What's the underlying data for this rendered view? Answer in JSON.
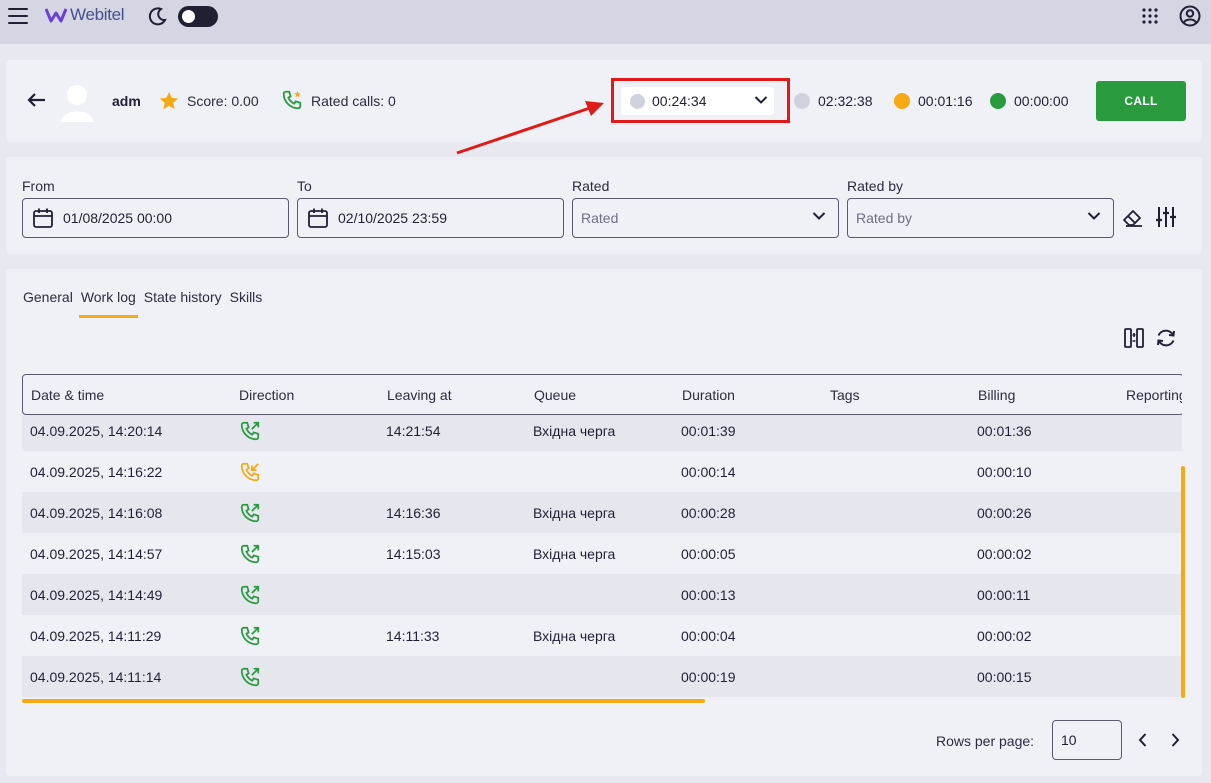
{
  "header": {
    "brand": "Webitel",
    "icons": [
      "menu-icon",
      "moon-icon",
      "theme-toggle",
      "apps-grid-icon",
      "profile-icon"
    ]
  },
  "agent": {
    "name": "adm",
    "score": "Score: 0.00",
    "rated_calls": "Rated calls: 0",
    "status_value": "00:24:34",
    "stats": [
      {
        "value": "02:32:38",
        "color": "#cfd1dc"
      },
      {
        "value": "00:01:16",
        "color": "#f7a913"
      },
      {
        "value": "00:00:00",
        "color": "#2a9a3f"
      }
    ],
    "call_label": "CALL"
  },
  "filters": {
    "from_label": "From",
    "from_value": "01/08/2025 00:00",
    "to_label": "To",
    "to_value": "02/10/2025 23:59",
    "rated_label": "Rated",
    "rated_placeholder": "Rated",
    "rated_by_label": "Rated by",
    "rated_by_placeholder": "Rated by"
  },
  "tabs": [
    "General",
    "Work log",
    "State history",
    "Skills"
  ],
  "active_tab": "Work log",
  "table": {
    "columns": [
      "Date & time",
      "Direction",
      "Leaving at",
      "Queue",
      "Duration",
      "Tags",
      "Billing",
      "Reporting"
    ],
    "rows": [
      {
        "datetime": "04.09.2025, 14:20:14",
        "direction": "outbound",
        "leaving_at": "14:21:54",
        "queue": "Вхідна черга",
        "duration": "00:01:39",
        "tags": "",
        "billing": "00:01:36"
      },
      {
        "datetime": "04.09.2025, 14:16:22",
        "direction": "missed",
        "leaving_at": "",
        "queue": "",
        "duration": "00:00:14",
        "tags": "",
        "billing": "00:00:10"
      },
      {
        "datetime": "04.09.2025, 14:16:08",
        "direction": "outbound",
        "leaving_at": "14:16:36",
        "queue": "Вхідна черга",
        "duration": "00:00:28",
        "tags": "",
        "billing": "00:00:26"
      },
      {
        "datetime": "04.09.2025, 14:14:57",
        "direction": "outbound",
        "leaving_at": "14:15:03",
        "queue": "Вхідна черга",
        "duration": "00:00:05",
        "tags": "",
        "billing": "00:00:02"
      },
      {
        "datetime": "04.09.2025, 14:14:49",
        "direction": "outbound",
        "leaving_at": "",
        "queue": "",
        "duration": "00:00:13",
        "tags": "",
        "billing": "00:00:11"
      },
      {
        "datetime": "04.09.2025, 14:11:29",
        "direction": "outbound",
        "leaving_at": "14:11:33",
        "queue": "Вхідна черга",
        "duration": "00:00:04",
        "tags": "",
        "billing": "00:00:02"
      },
      {
        "datetime": "04.09.2025, 14:11:14",
        "direction": "outbound",
        "leaving_at": "",
        "queue": "",
        "duration": "00:00:19",
        "tags": "",
        "billing": "00:00:15"
      }
    ]
  },
  "pagination": {
    "rows_per_page_label": "Rows per page:",
    "rows_per_page_value": "10"
  },
  "colors": {
    "accent": "#f7a913",
    "call_green": "#2a9a3f",
    "highlight_red": "#e01919"
  }
}
